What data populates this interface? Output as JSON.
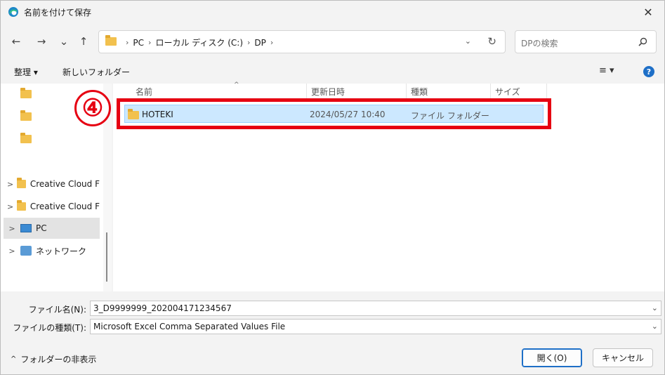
{
  "window": {
    "title": "名前を付けて保存",
    "close": "✕"
  },
  "nav": {
    "back": "←",
    "forward": "→",
    "recent": "⌄",
    "up": "↑",
    "breadcrumbs": [
      "PC",
      "ローカル ディスク (C:)",
      "DP"
    ],
    "search_placeholder": "DPの検索"
  },
  "toolbar": {
    "organize": "整理 ▾",
    "new_folder": "新しいフォルダー",
    "help": "?"
  },
  "sidebar": {
    "items": [
      {
        "label": "",
        "type": "folder"
      },
      {
        "label": "",
        "type": "folder"
      },
      {
        "label": "",
        "type": "folder"
      },
      {
        "label": "Creative Cloud F",
        "type": "folder",
        "chevron": ">"
      },
      {
        "label": "Creative Cloud F",
        "type": "folder",
        "chevron": ">"
      },
      {
        "label": "PC",
        "type": "pc",
        "chevron": ">",
        "selected": true
      },
      {
        "label": "ネットワーク",
        "type": "network",
        "chevron": ">"
      }
    ]
  },
  "file_list": {
    "columns": [
      "名前",
      "更新日時",
      "種類",
      "サイズ"
    ],
    "rows": [
      {
        "name": "HOTEKI",
        "modified": "2024/05/27 10:40",
        "type": "ファイル フォルダー",
        "size": ""
      }
    ]
  },
  "annotation": {
    "step_number": "④",
    "color": "#e60012"
  },
  "bottom": {
    "filename_label": "ファイル名(N):",
    "filename_value": "3_D9999999_202004171234567",
    "filetype_label": "ファイルの種類(T):",
    "filetype_value": "Microsoft Excel Comma Separated Values File",
    "hide_folders": "フォルダーの非表示",
    "open_button": "開く(O)",
    "cancel_button": "キャンセル"
  },
  "colors": {
    "selection": "#cce8ff",
    "accent": "#1e6fc7"
  }
}
